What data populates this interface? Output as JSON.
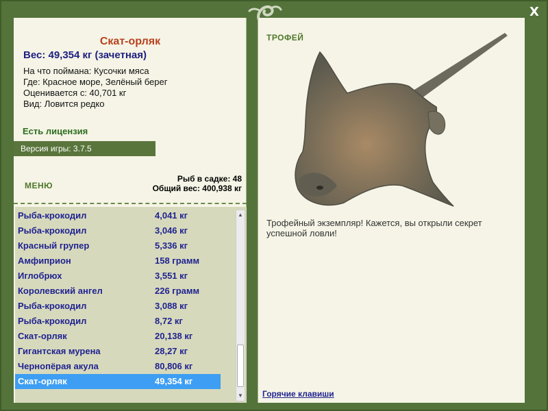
{
  "window": {
    "close_label": "X"
  },
  "fish": {
    "title": "Скат-орляк",
    "weight": "Вес: 49,354 кг (зачетная)",
    "info": [
      "На что поймана: Кусочки мяса",
      "Где: Красное море, Зелёный берег",
      "Оценивается с: 40,701 кг",
      "Вид: Ловится редко"
    ],
    "license": "Есть лицензия"
  },
  "version": "Версия игры: 3.7.5",
  "menu": {
    "label": "МЕНЮ"
  },
  "stats": {
    "count": "Рыб в садке: 48",
    "total": "Общий вес: 400,938 кг"
  },
  "list": [
    {
      "name": "Рыба-крокодил",
      "weight": "4,041 кг"
    },
    {
      "name": "Рыба-крокодил",
      "weight": "3,046 кг"
    },
    {
      "name": "Красный групер",
      "weight": "5,336 кг"
    },
    {
      "name": "Амфиприон",
      "weight": "158 грамм"
    },
    {
      "name": "Иглобрюх",
      "weight": "3,551 кг"
    },
    {
      "name": "Королевский ангел",
      "weight": "226 грамм"
    },
    {
      "name": "Рыба-крокодил",
      "weight": "3,088 кг"
    },
    {
      "name": "Рыба-крокодил",
      "weight": "8,72 кг"
    },
    {
      "name": "Скат-орляк",
      "weight": "20,138 кг"
    },
    {
      "name": "Гигантская мурена",
      "weight": "28,27 кг"
    },
    {
      "name": "Чернопёрая акула",
      "weight": "80,806 кг"
    },
    {
      "name": "Скат-орляк",
      "weight": "49,354 кг"
    }
  ],
  "selected_index": 11,
  "trophy": {
    "label": "ТРОФЕЙ",
    "description": "Трофейный экземпляр! Кажется, вы открыли секрет успешной ловли!"
  },
  "hotkeys": "Горячие клавиши",
  "icons": {
    "logo": "lizard-logo-icon",
    "scroll_up": "arrow-up-icon",
    "scroll_down": "arrow-down-icon",
    "fish_image": "eagle-ray-image"
  },
  "colors": {
    "frame": "#53733a",
    "panel": "#f5f4e6",
    "title": "#b8421f",
    "weight": "#1f2080",
    "accent_green": "#50762b",
    "selection": "#3d9ef3",
    "list_bg": "#d7d9bc"
  }
}
